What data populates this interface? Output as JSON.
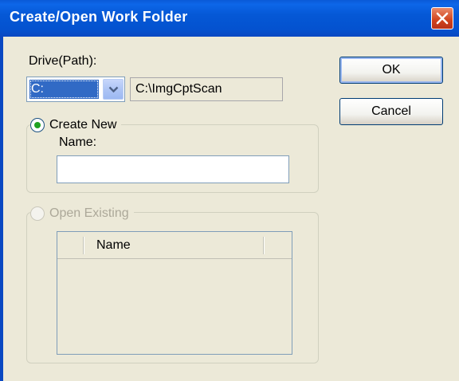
{
  "window": {
    "title": "Create/Open Work Folder"
  },
  "drive": {
    "label": "Drive(Path):",
    "selected": "C:",
    "path": "C:\\ImgCptScan"
  },
  "create_new": {
    "label": "Create New",
    "name_label": "Name:",
    "name_value": ""
  },
  "open_existing": {
    "label": "Open Existing",
    "column_name": "Name"
  },
  "buttons": {
    "ok": "OK",
    "cancel": "Cancel"
  },
  "icons": {
    "close": "close-icon",
    "dropdown": "chevron-down-icon"
  },
  "colors": {
    "titlebar": "#0558d6",
    "selection": "#316ac5",
    "background": "#ece9d8"
  }
}
